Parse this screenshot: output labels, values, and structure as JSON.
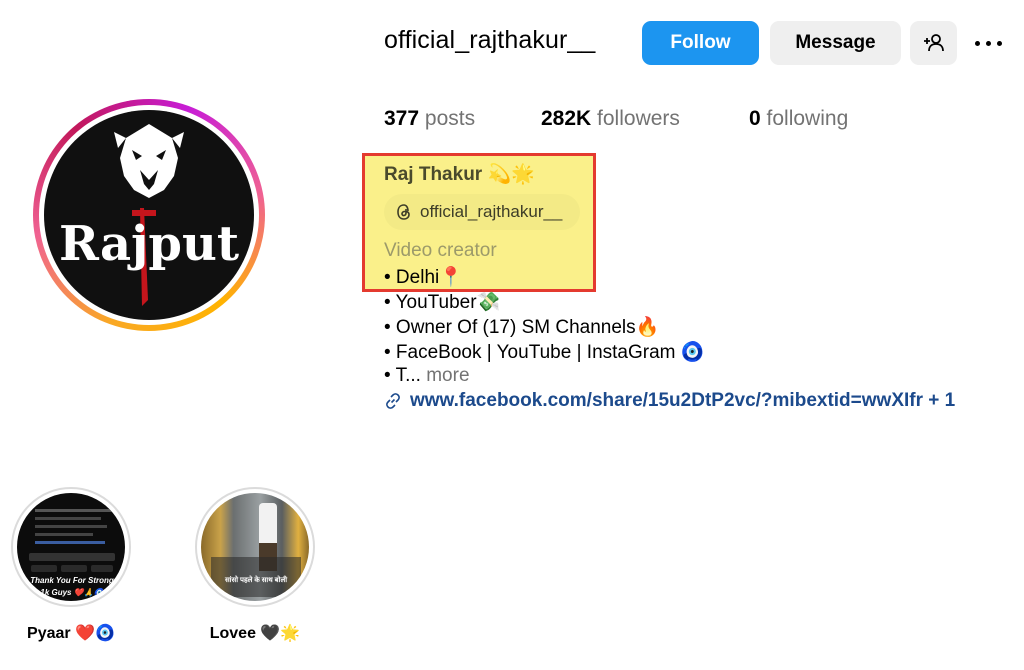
{
  "profile": {
    "username": "official_rajthakur__",
    "avatar_text": "Rajput"
  },
  "actions": {
    "follow_label": "Follow",
    "message_label": "Message",
    "add_user_icon": "person-add-icon",
    "more_icon": "more-horizontal-icon"
  },
  "stats": {
    "posts_count": "377",
    "posts_label": "posts",
    "followers_count": "282K",
    "followers_label": "followers",
    "following_count": "0",
    "following_label": "following"
  },
  "bio": {
    "name": "Raj Thakur 💫🌟",
    "threads_handle": "official_rajthakur__",
    "category": "Video creator",
    "lines": [
      "• Delhi📍",
      "• YouTuber💸",
      "• Owner Of (17) SM Channels🔥",
      "• FaceBook | YouTube | InstaGram 🧿",
      "• T..."
    ],
    "more_label": "more",
    "link": "www.facebook.com/share/15u2DtP2vc/?mibextid=wwXIfr + 1"
  },
  "highlights": [
    {
      "label": "Pyaar ❤️🧿",
      "thumb_text_1": "Thank You For Strong",
      "thumb_text_2": "1k Guys ❤️🙏🧿"
    },
    {
      "label": "Lovee 🖤🌟",
      "thumb_text_1": "सांसो पहले के साथ बोली"
    }
  ],
  "colors": {
    "follow_blue": "#1c95f0",
    "highlight_yellow": "#faf08a",
    "highlight_border": "#e43a2f",
    "link_color": "#1c4a8c"
  }
}
